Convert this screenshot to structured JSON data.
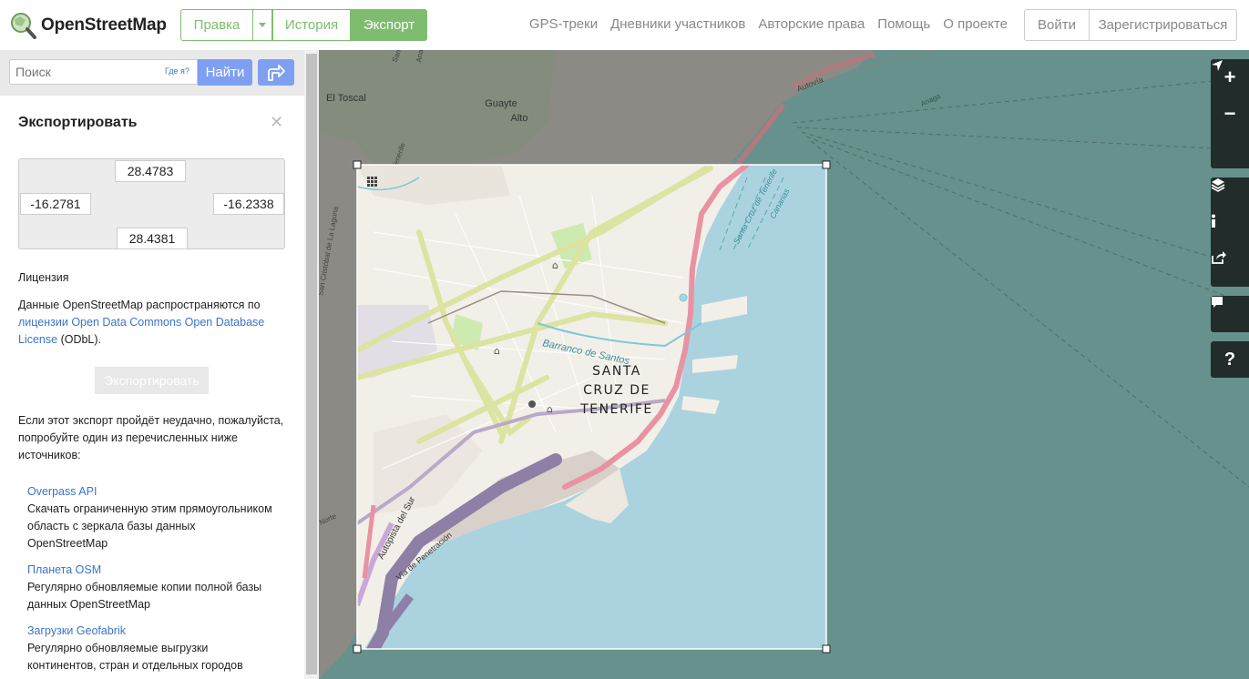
{
  "header": {
    "brand": "OpenStreetMap",
    "tabs": {
      "edit": "Правка",
      "history": "История",
      "export": "Экспорт"
    },
    "nav": [
      "GPS-треки",
      "Дневники участников",
      "Авторские права",
      "Помощь",
      "О проекте"
    ],
    "login": "Войти",
    "signup": "Зарегистрироваться"
  },
  "search": {
    "placeholder": "Поиск",
    "where_am_i": "Где я?",
    "button": "Найти"
  },
  "export": {
    "title": "Экспортировать",
    "bbox": {
      "north": "28.4783",
      "west": "-16.2781",
      "east": "-16.2338",
      "south": "28.4381"
    },
    "license_heading": "Лицензия",
    "license_text_1": "Данные OpenStreetMap распространяются по",
    "license_link_1": "лицензии Open Data Commons Open Database",
    "license_link_2": "License",
    "license_text_2": " (ODbL).",
    "export_button": "Экспортировать",
    "fail_text_1": "Если этот экспорт пройдёт неудачно, пожалуйста,",
    "fail_text_2": "попробуйте один из перечисленных ниже",
    "fail_text_3": "источников:",
    "sources": [
      {
        "title": "Overpass API",
        "lines": [
          "Скачать ограниченную этим прямоугольником",
          "область с зеркала базы данных",
          "OpenStreetMap"
        ]
      },
      {
        "title": "Планета OSM",
        "lines": [
          "Регулярно обновляемые копии полной базы",
          "данных OpenStreetMap"
        ]
      },
      {
        "title": "Загрузки Geofabrik",
        "lines": [
          "Регулярно обновляемые выгрузки",
          "континентов, стран и отдельных городов"
        ]
      }
    ]
  },
  "map": {
    "city_label": [
      "SANTA",
      "CRUZ DE",
      "TENERIFE"
    ],
    "labels": {
      "el_toscal": "El Toscal",
      "guayte": "Guayte",
      "alto": "Alto",
      "autovia": "Autovía",
      "barranco": "Barranco de Santos",
      "autopista": "Autopista del Sur",
      "via": "Vía de Penetración",
      "santa_cruz_road": "Santa Cruz de Tenerife",
      "canarias": "Canarias",
      "anaga": "Anaga",
      "cristobal": "San Cristóbal de La Laguna",
      "norte": "Norte",
      "cristobal_top": "San Cristóbal",
      "santa_cruz_top": "Santa Cruz de Tenerife",
      "anaga_top": "Anaga",
      "anaga_ne": "Anaga"
    },
    "colors": {
      "sea": "#aad3df",
      "land": "#f2efe9",
      "motorway": "#e892a2",
      "trunk": "#c9a8d6",
      "primary": "#dde3a0"
    }
  },
  "controls": [
    "zoom-in",
    "zoom-out",
    "locate",
    "layers",
    "info",
    "share",
    "note",
    "help"
  ]
}
